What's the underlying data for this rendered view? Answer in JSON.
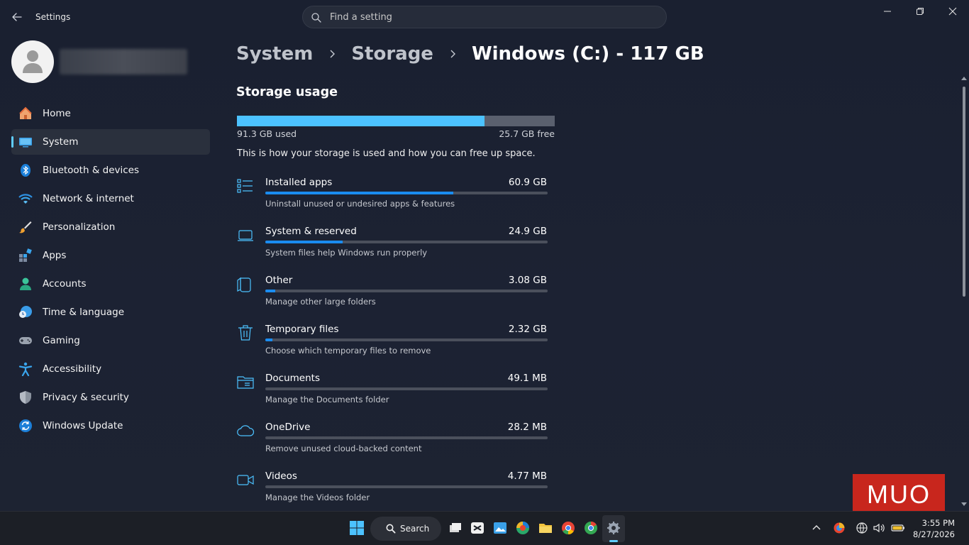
{
  "app": {
    "title": "Settings",
    "search_placeholder": "Find a setting"
  },
  "breadcrumb": {
    "items": [
      "System",
      "Storage",
      "Windows (C:) - 117 GB"
    ]
  },
  "sidebar": {
    "items": [
      {
        "label": "Home",
        "icon": "home-icon"
      },
      {
        "label": "System",
        "icon": "system-display-icon",
        "selected": true
      },
      {
        "label": "Bluetooth & devices",
        "icon": "bluetooth-icon"
      },
      {
        "label": "Network & internet",
        "icon": "wifi-icon"
      },
      {
        "label": "Personalization",
        "icon": "brush-icon"
      },
      {
        "label": "Apps",
        "icon": "apps-icon"
      },
      {
        "label": "Accounts",
        "icon": "account-icon"
      },
      {
        "label": "Time & language",
        "icon": "clock-globe-icon"
      },
      {
        "label": "Gaming",
        "icon": "gamepad-icon"
      },
      {
        "label": "Accessibility",
        "icon": "accessibility-icon"
      },
      {
        "label": "Privacy & security",
        "icon": "shield-icon"
      },
      {
        "label": "Windows Update",
        "icon": "update-icon"
      }
    ]
  },
  "storage": {
    "section_title": "Storage usage",
    "used_label": "91.3 GB used",
    "free_label": "25.7 GB free",
    "used_fraction": 0.78,
    "description": "This is how your storage is used and how you can free up space.",
    "categories": [
      {
        "name": "Installed apps",
        "size": "60.9 GB",
        "subtitle": "Uninstall unused or undesired apps & features",
        "fraction": 0.667,
        "icon": "list-icon"
      },
      {
        "name": "System & reserved",
        "size": "24.9 GB",
        "subtitle": "System files help Windows run properly",
        "fraction": 0.273,
        "icon": "laptop-icon"
      },
      {
        "name": "Other",
        "size": "3.08 GB",
        "subtitle": "Manage other large folders",
        "fraction": 0.034,
        "icon": "copy-icon"
      },
      {
        "name": "Temporary files",
        "size": "2.32 GB",
        "subtitle": "Choose which temporary files to remove",
        "fraction": 0.025,
        "icon": "trash-icon"
      },
      {
        "name": "Documents",
        "size": "49.1 MB",
        "subtitle": "Manage the Documents folder",
        "fraction": 0.0,
        "icon": "folder-icon"
      },
      {
        "name": "OneDrive",
        "size": "28.2 MB",
        "subtitle": "Remove unused cloud-backed content",
        "fraction": 0.0,
        "icon": "cloud-icon"
      },
      {
        "name": "Videos",
        "size": "4.77 MB",
        "subtitle": "Manage the Videos folder",
        "fraction": 0.0,
        "icon": "video-icon"
      }
    ]
  },
  "watermark": {
    "text": "MUO"
  },
  "taskbar": {
    "search_label": "Search",
    "time": "3:55 PM",
    "date": "8/27/2026"
  },
  "colors": {
    "accent": "#60cdff",
    "bar_fill": "#1a8cf0",
    "usage_fill": "#4cc2ff"
  }
}
